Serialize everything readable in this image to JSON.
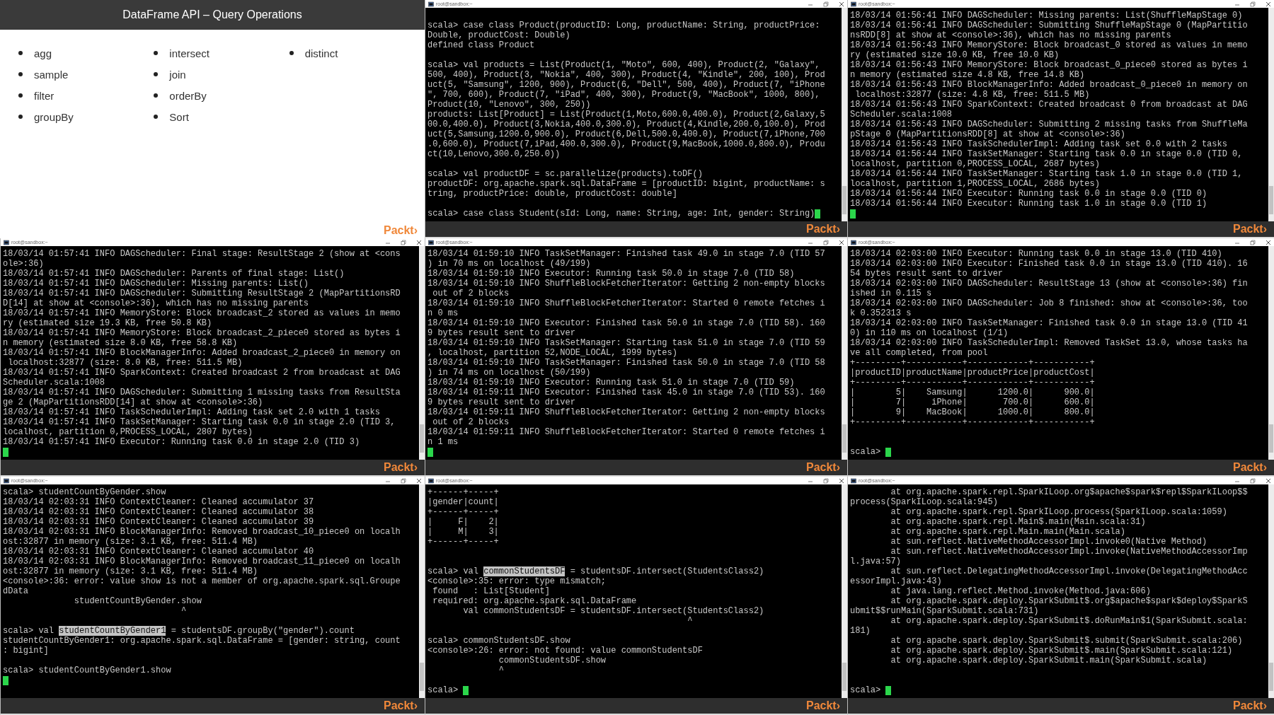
{
  "slide": {
    "title": "DataFrame API – Query Operations",
    "columns": [
      [
        "agg",
        "sample",
        "filter",
        "groupBy"
      ],
      [
        "intersect",
        "join",
        "orderBy",
        "Sort"
      ],
      [
        "distinct"
      ]
    ],
    "logo": "Packt›"
  },
  "terminals": [
    {
      "kind": "terminal",
      "title": "root@sandbox:~",
      "cursor": true,
      "logo": "Packt›",
      "lines": [
        {
          "kind": "blank"
        },
        "scala> case class Product(productID: Long, productName: String, productPrice:",
        "Double, productCost: Double)",
        "defined class Product",
        {
          "kind": "blank"
        },
        "scala> val products = List(Product(1, \"Moto\", 600, 400), Product(2, \"Galaxy\",",
        "500, 400), Product(3, \"Nokia\", 400, 300), Product(4, \"Kindle\", 200, 100), Prod",
        "uct(5, \"Samsung\", 1200, 900), Product(6, \"Dell\", 500, 400), Product(7, \"iPhone",
        "\", 700, 600), Product(7, \"iPad\", 400, 300), Product(9, \"MacBook\", 1000, 800),",
        "Product(10, \"Lenovo\", 300, 250))",
        "products: List[Product] = List(Product(1,Moto,600.0,400.0), Product(2,Galaxy,5",
        "00.0,400.0), Product(3,Nokia,400.0,300.0), Product(4,Kindle,200.0,100.0), Prod",
        "uct(5,Samsung,1200.0,900.0), Product(6,Dell,500.0,400.0), Product(7,iPhone,700",
        ".0,600.0), Product(7,iPad,400.0,300.0), Product(9,MacBook,1000.0,800.0), Produ",
        "ct(10,Lenovo,300.0,250.0))",
        {
          "kind": "blank"
        },
        "scala> val productDF = sc.parallelize(products).toDF()",
        "productDF: org.apache.spark.sql.DataFrame = [productID: bigint, productName: s",
        "tring, productPrice: double, productCost: double]",
        {
          "kind": "blank"
        },
        "scala> case class Student(sId: Long, name: String, age: Int, gender: String)"
      ]
    },
    {
      "kind": "terminal",
      "title": "root@sandbox:~",
      "cursor": true,
      "logo": "Packt›",
      "lines": [
        "18/03/14 01:56:41 INFO DAGScheduler: Missing parents: List(ShuffleMapStage 0)",
        "18/03/14 01:56:41 INFO DAGScheduler: Submitting ShuffleMapStage 0 (MapPartitio",
        "nsRDD[8] at show at <console>:36), which has no missing parents",
        "18/03/14 01:56:43 INFO MemoryStore: Block broadcast_0 stored as values in memo",
        "ry (estimated size 10.0 KB, free 10.0 KB)",
        "18/03/14 01:56:43 INFO MemoryStore: Block broadcast_0_piece0 stored as bytes i",
        "n memory (estimated size 4.8 KB, free 14.8 KB)",
        "18/03/14 01:56:43 INFO BlockManagerInfo: Added broadcast_0_piece0 in memory on",
        " localhost:32877 (size: 4.8 KB, free: 511.5 MB)",
        "18/03/14 01:56:43 INFO SparkContext: Created broadcast 0 from broadcast at DAG",
        "Scheduler.scala:1008",
        "18/03/14 01:56:43 INFO DAGScheduler: Submitting 2 missing tasks from ShuffleMa",
        "pStage 0 (MapPartitionsRDD[8] at show at <console>:36)",
        "18/03/14 01:56:43 INFO TaskSchedulerImpl: Adding task set 0.0 with 2 tasks",
        "18/03/14 01:56:44 INFO TaskSetManager: Starting task 0.0 in stage 0.0 (TID 0,",
        "localhost, partition 0,PROCESS_LOCAL, 2687 bytes)",
        "18/03/14 01:56:44 INFO TaskSetManager: Starting task 1.0 in stage 0.0 (TID 1,",
        "localhost, partition 1,PROCESS_LOCAL, 2686 bytes)",
        "18/03/14 01:56:44 INFO Executor: Running task 0.0 in stage 0.0 (TID 0)",
        "18/03/14 01:56:44 INFO Executor: Running task 1.0 in stage 0.0 (TID 1)",
        {
          "kind": "blank"
        }
      ]
    },
    {
      "kind": "terminal",
      "title": "root@sandbox:~",
      "cursor": true,
      "logo": "Packt›",
      "lines": [
        "18/03/14 01:57:41 INFO DAGScheduler: Final stage: ResultStage 2 (show at <cons",
        "ole>:36)",
        "18/03/14 01:57:41 INFO DAGScheduler: Parents of final stage: List()",
        "18/03/14 01:57:41 INFO DAGScheduler: Missing parents: List()",
        "18/03/14 01:57:41 INFO DAGScheduler: Submitting ResultStage 2 (MapPartitionsRD",
        "D[14] at show at <console>:36), which has no missing parents",
        "18/03/14 01:57:41 INFO MemoryStore: Block broadcast_2 stored as values in memo",
        "ry (estimated size 19.3 KB, free 50.8 KB)",
        "18/03/14 01:57:41 INFO MemoryStore: Block broadcast_2_piece0 stored as bytes i",
        "n memory (estimated size 8.0 KB, free 58.8 KB)",
        "18/03/14 01:57:41 INFO BlockManagerInfo: Added broadcast_2_piece0 in memory on",
        " localhost:32877 (size: 8.0 KB, free: 511.5 MB)",
        "18/03/14 01:57:41 INFO SparkContext: Created broadcast 2 from broadcast at DAG",
        "Scheduler.scala:1008",
        "18/03/14 01:57:41 INFO DAGScheduler: Submitting 1 missing tasks from ResultSta",
        "ge 2 (MapPartitionsRDD[14] at show at <console>:36)",
        "18/03/14 01:57:41 INFO TaskSchedulerImpl: Adding task set 2.0 with 1 tasks",
        "18/03/14 01:57:41 INFO TaskSetManager: Starting task 0.0 in stage 2.0 (TID 3,",
        "localhost, partition 0,PROCESS_LOCAL, 2807 bytes)",
        "18/03/14 01:57:41 INFO Executor: Running task 0.0 in stage 2.0 (TID 3)",
        {
          "kind": "blank"
        }
      ]
    },
    {
      "kind": "terminal",
      "title": "root@sandbox:~",
      "cursor": true,
      "logo": "Packt›",
      "lines": [
        "18/03/14 01:59:10 INFO TaskSetManager: Finished task 49.0 in stage 7.0 (TID 57",
        ") in 70 ms on localhost (49/199)",
        "18/03/14 01:59:10 INFO Executor: Running task 50.0 in stage 7.0 (TID 58)",
        "18/03/14 01:59:10 INFO ShuffleBlockFetcherIterator: Getting 2 non-empty blocks",
        " out of 2 blocks",
        "18/03/14 01:59:10 INFO ShuffleBlockFetcherIterator: Started 0 remote fetches i",
        "n 0 ms",
        "18/03/14 01:59:10 INFO Executor: Finished task 50.0 in stage 7.0 (TID 58). 160",
        "9 bytes result sent to driver",
        "18/03/14 01:59:10 INFO TaskSetManager: Starting task 51.0 in stage 7.0 (TID 59",
        ", localhost, partition 52,NODE_LOCAL, 1999 bytes)",
        "18/03/14 01:59:10 INFO TaskSetManager: Finished task 50.0 in stage 7.0 (TID 58",
        ") in 74 ms on localhost (50/199)",
        "18/03/14 01:59:10 INFO Executor: Running task 51.0 in stage 7.0 (TID 59)",
        "18/03/14 01:59:11 INFO Executor: Finished task 45.0 in stage 7.0 (TID 53). 160",
        "9 bytes result sent to driver",
        "18/03/14 01:59:11 INFO ShuffleBlockFetcherIterator: Getting 2 non-empty blocks",
        " out of 2 blocks",
        "18/03/14 01:59:11 INFO ShuffleBlockFetcherIterator: Started 0 remote fetches i",
        "n 1 ms",
        {
          "kind": "blank"
        }
      ]
    },
    {
      "kind": "terminal",
      "title": "root@sandbox:~",
      "cursor": true,
      "logo": "Packt›",
      "lines": [
        "18/03/14 02:03:00 INFO Executor: Running task 0.0 in stage 13.0 (TID 410)",
        "18/03/14 02:03:00 INFO Executor: Finished task 0.0 in stage 13.0 (TID 410). 16",
        "54 bytes result sent to driver",
        "18/03/14 02:03:00 INFO DAGScheduler: ResultStage 13 (show at <console>:36) fin",
        "ished in 0.115 s",
        "18/03/14 02:03:00 INFO DAGScheduler: Job 8 finished: show at <console>:36, too",
        "k 0.352313 s",
        "18/03/14 02:03:00 INFO TaskSetManager: Finished task 0.0 in stage 13.0 (TID 41",
        "0) in 110 ms on localhost (1/1)",
        "18/03/14 02:03:00 INFO TaskSchedulerImpl: Removed TaskSet 13.0, whose tasks ha",
        "ve all completed, from pool",
        "+---------+-----------+------------+-----------+",
        "|productID|productName|productPrice|productCost|",
        "+---------+-----------+------------+-----------+",
        "|        5|    Samsung|      1200.0|      900.0|",
        "|        7|     iPhone|       700.0|      600.0|",
        "|        9|    MacBook|      1000.0|      800.0|",
        "+---------+-----------+------------+-----------+",
        {
          "kind": "blank"
        },
        {
          "kind": "blank"
        },
        "scala> "
      ]
    },
    {
      "kind": "terminal",
      "title": "root@sandbox:~",
      "cursor": true,
      "logo": "Packt›",
      "lines": [
        "scala> studentCountByGender.show",
        "18/03/14 02:03:31 INFO ContextCleaner: Cleaned accumulator 37",
        "18/03/14 02:03:31 INFO ContextCleaner: Cleaned accumulator 38",
        "18/03/14 02:03:31 INFO ContextCleaner: Cleaned accumulator 39",
        "18/03/14 02:03:31 INFO BlockManagerInfo: Removed broadcast_10_piece0 on localh",
        "ost:32877 in memory (size: 3.1 KB, free: 511.4 MB)",
        "18/03/14 02:03:31 INFO ContextCleaner: Cleaned accumulator 40",
        "18/03/14 02:03:31 INFO BlockManagerInfo: Removed broadcast_11_piece0 on localh",
        "ost:32877 in memory (size: 3.1 KB, free: 511.4 MB)",
        "<console>:36: error: value show is not a member of org.apache.spark.sql.Groupe",
        "dData",
        "              studentCountByGender.show",
        "                                   ^",
        {
          "kind": "blank"
        },
        {
          "kind": "selection",
          "parts": [
            {
              "text": "scala> val ",
              "selected": false
            },
            {
              "text": "studentCountByGender1",
              "selected": true
            },
            {
              "text": " = studentsDF.groupBy(\"gender\").count",
              "selected": false
            }
          ]
        },
        "studentCountByGender1: org.apache.spark.sql.DataFrame = [gender: string, count",
        ": bigint]",
        {
          "kind": "blank"
        },
        "scala> studentCountByGender1.show",
        {
          "kind": "blank"
        }
      ]
    },
    {
      "kind": "terminal",
      "title": "root@sandbox:~",
      "cursor": true,
      "logo": "Packt›",
      "lines": [
        "+------+-----+",
        "|gender|count|",
        "+------+-----+",
        "|     F|    2|",
        "|     M|    3|",
        "+------+-----+",
        {
          "kind": "blank"
        },
        {
          "kind": "blank"
        },
        {
          "kind": "selection",
          "parts": [
            {
              "text": "scala> val ",
              "selected": false
            },
            {
              "text": "commonStudentsDF",
              "selected": true
            },
            {
              "text": " = studentsDF.intersect(StudentsClass2)",
              "selected": false
            }
          ]
        },
        "<console>:35: error: type mismatch;",
        " found   : List[Student]",
        " required: org.apache.spark.sql.DataFrame",
        "       val commonStudentsDF = studentsDF.intersect(StudentsClass2)",
        "                                                   ^",
        {
          "kind": "blank"
        },
        "scala> commonStudentsDF.show",
        "<console>:26: error: not found: value commonStudentsDF",
        "              commonStudentsDF.show",
        "              ^",
        {
          "kind": "blank"
        },
        "scala> "
      ]
    },
    {
      "kind": "terminal",
      "title": "root@sandbox:~",
      "cursor": true,
      "logo": "Packt›",
      "lines": [
        "        at org.apache.spark.repl.SparkILoop.org$apache$spark$repl$SparkILoop$$",
        "process(SparkILoop.scala:945)",
        "        at org.apache.spark.repl.SparkILoop.process(SparkILoop.scala:1059)",
        "        at org.apache.spark.repl.Main$.main(Main.scala:31)",
        "        at org.apache.spark.repl.Main.main(Main.scala)",
        "        at sun.reflect.NativeMethodAccessorImpl.invoke0(Native Method)",
        "        at sun.reflect.NativeMethodAccessorImpl.invoke(NativeMethodAccessorImp",
        "l.java:57)",
        "        at sun.reflect.DelegatingMethodAccessorImpl.invoke(DelegatingMethodAcc",
        "essorImpl.java:43)",
        "        at java.lang.reflect.Method.invoke(Method.java:606)",
        "        at org.apache.spark.deploy.SparkSubmit$.org$apache$spark$deploy$SparkS",
        "ubmit$$runMain(SparkSubmit.scala:731)",
        "        at org.apache.spark.deploy.SparkSubmit$.doRunMain$1(SparkSubmit.scala:",
        "181)",
        "        at org.apache.spark.deploy.SparkSubmit$.submit(SparkSubmit.scala:206)",
        "        at org.apache.spark.deploy.SparkSubmit$.main(SparkSubmit.scala:121)",
        "        at org.apache.spark.deploy.SparkSubmit.main(SparkSubmit.scala)",
        {
          "kind": "blank"
        },
        {
          "kind": "blank"
        },
        "scala> "
      ]
    }
  ]
}
